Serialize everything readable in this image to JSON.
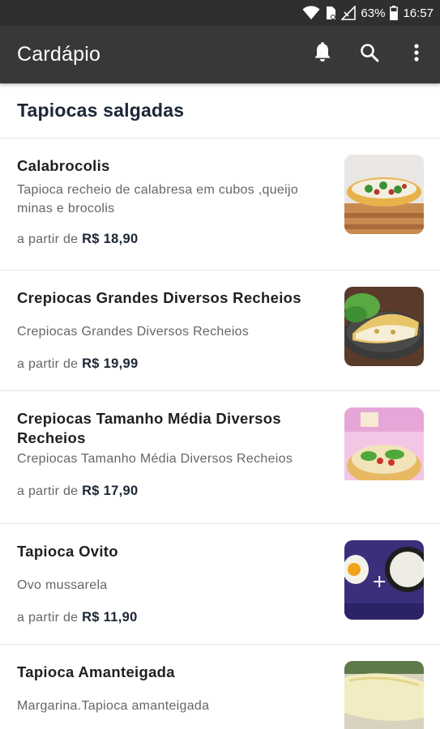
{
  "status": {
    "battery": "63%",
    "time": "16:57"
  },
  "app_bar": {
    "title": "Cardápio"
  },
  "section": {
    "title": "Tapiocas salgadas"
  },
  "items": [
    {
      "name": "Calabrocolis",
      "description": "Tapioca  recheio de calabresa em cubos ,queijo minas e brocolis",
      "price_prefix": "a partir de ",
      "price": "R$ 18,90"
    },
    {
      "name": "Crepiocas Grandes Diversos Recheios",
      "description": "Crepiocas Grandes Diversos Recheios",
      "price_prefix": "a partir de ",
      "price": "R$ 19,99"
    },
    {
      "name": "Crepiocas Tamanho  Média  Diversos Recheios",
      "description": "Crepiocas Tamanho  Média  Diversos Recheios",
      "price_prefix": "a partir de ",
      "price": "R$ 17,90"
    },
    {
      "name": "Tapioca  Ovito",
      "description": "Ovo  mussarela",
      "price_prefix": "a partir de ",
      "price": "R$ 11,90"
    },
    {
      "name": "Tapioca Amanteigada",
      "description": "Margarina.Tapioca amanteigada",
      "price_prefix": "",
      "price": ""
    }
  ]
}
